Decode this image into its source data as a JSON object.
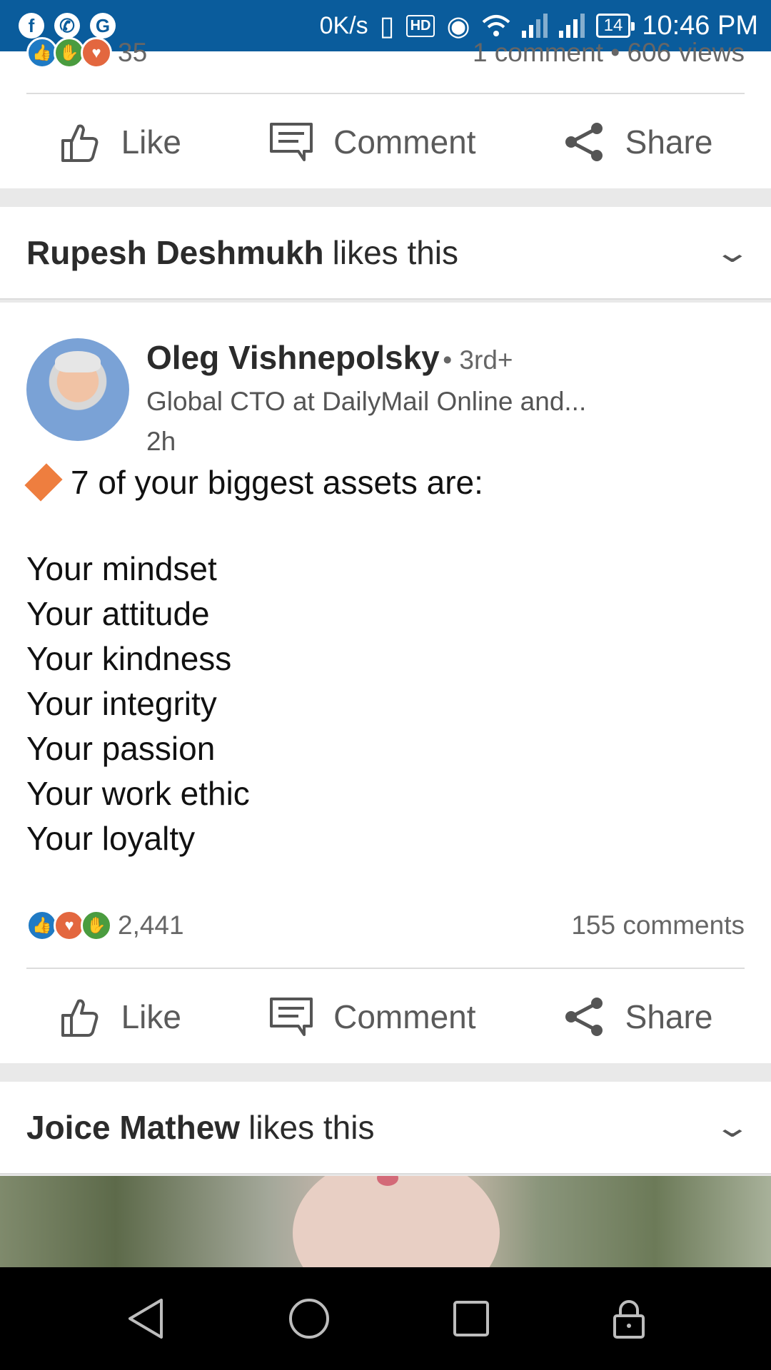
{
  "status_bar": {
    "apps": [
      "f",
      "✆",
      "G"
    ],
    "net_speed": "0K/s",
    "hd": "HD",
    "battery": "14",
    "time": "10:46 PM"
  },
  "post_prev": {
    "reaction_count": "35",
    "stats_right": "1 comment • 606 views"
  },
  "actions": {
    "like": "Like",
    "comment": "Comment",
    "share": "Share"
  },
  "activity_1": {
    "name": "Rupesh Deshmukh",
    "suffix": "likes this"
  },
  "post": {
    "author": "Oleg Vishnepolsky",
    "degree": "• 3rd+",
    "headline": "Global CTO at DailyMail Online and...",
    "time": "2h",
    "first_line": "7 of your biggest assets are:",
    "assets": [
      "Your mindset",
      "Your attitude",
      "Your kindness",
      "Your integrity",
      "Your passion",
      "Your work ethic",
      "Your loyalty"
    ],
    "reaction_count": "2,441",
    "comments": "155 comments"
  },
  "activity_2": {
    "name": "Joice Mathew",
    "suffix": "likes this"
  }
}
